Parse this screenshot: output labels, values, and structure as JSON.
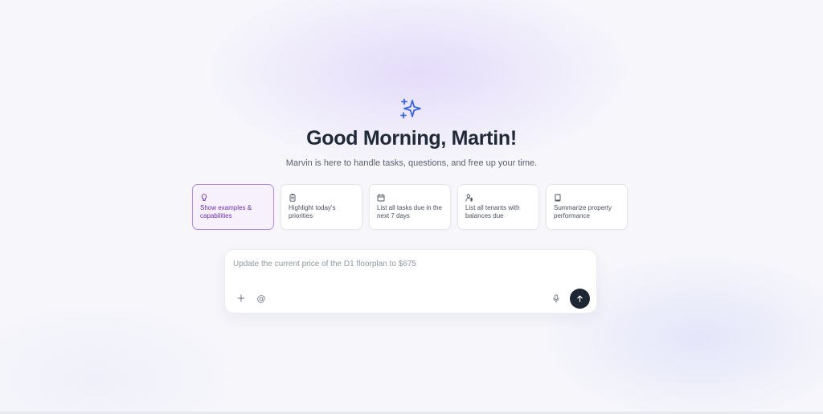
{
  "hero": {
    "icon": "sparkle-icon",
    "accent_color": "#3b66e0",
    "greeting": "Good Morning, Martin!",
    "subtitle": "Marvin is here to handle tasks, questions, and free up your time."
  },
  "suggestions": [
    {
      "icon": "lightbulb-icon",
      "label": "Show examples & capabilities",
      "selected": true
    },
    {
      "icon": "clipboard-icon",
      "label": "Highlight today's priorities",
      "selected": false
    },
    {
      "icon": "calendar-icon",
      "label": "List all tasks due in the next 7 days",
      "selected": false
    },
    {
      "icon": "user-dollar-icon",
      "label": "List all tenants with balances due",
      "selected": false
    },
    {
      "icon": "book-icon",
      "label": "Summarize property performance",
      "selected": false
    }
  ],
  "composer": {
    "placeholder": "Update the current price of the D1 floorplan to $675",
    "value": "",
    "attach_icon": "plus-icon",
    "mention_label": "@",
    "mention_icon": "at-icon",
    "mic_icon": "microphone-icon",
    "send_icon": "arrow-up-icon"
  },
  "colors": {
    "selected_card_border": "#b48ce0",
    "selected_card_bg": "#f7f1fd",
    "selected_card_text": "#6b2fae",
    "send_button": "#1e2533"
  }
}
